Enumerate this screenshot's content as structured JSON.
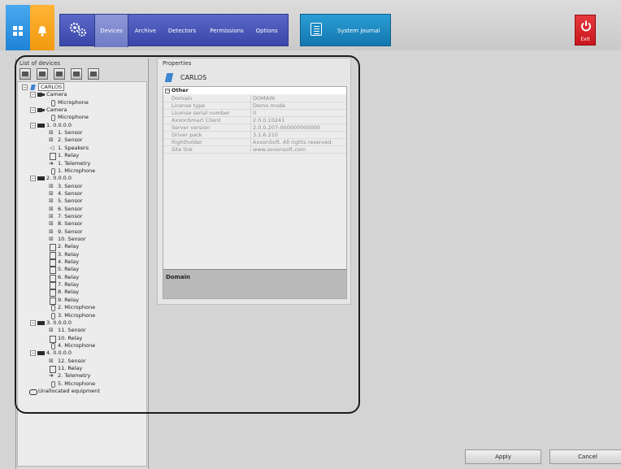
{
  "nav": {
    "tabs": [
      "Devices",
      "Archive",
      "Detectors",
      "Permissions",
      "Options"
    ],
    "active": "Devices",
    "journal": "System journal",
    "exit": "Exit",
    "colors": {
      "nav_blue": "#3a46a8",
      "journal_blue": "#1476b0",
      "exit_red": "#c8161c",
      "tile_blue": "#1f82d6",
      "tile_orange": "#f19a0f"
    }
  },
  "left_panel": {
    "title": "List of devices",
    "toolbar_icons": [
      "add-camera-icon",
      "add-device-icon",
      "add-sensor-icon",
      "add-relay-icon",
      "add-speaker-icon"
    ],
    "tree": [
      {
        "text": "CARLOS",
        "icon": "root"
      },
      {
        "text": "Camera",
        "icon": "cam"
      },
      {
        "text": "Microphone",
        "icon": "mic"
      },
      {
        "text": "Camera",
        "icon": "cam"
      },
      {
        "text": "Microphone",
        "icon": "mic"
      },
      {
        "text": "1. 0.0.0.0",
        "icon": "srv"
      },
      {
        "text": "1. Sensor",
        "icon": "sensor"
      },
      {
        "text": "2. Sensor",
        "icon": "sensor"
      },
      {
        "text": "1. Speakers",
        "icon": "spk"
      },
      {
        "text": "1. Relay",
        "icon": "relay"
      },
      {
        "text": "1. Telemetry",
        "icon": "tele"
      },
      {
        "text": "1. Microphone",
        "icon": "mic"
      },
      {
        "text": "2. 0.0.0.0",
        "icon": "srv"
      },
      {
        "text": "3. Sensor",
        "icon": "sensor"
      },
      {
        "text": "4. Sensor",
        "icon": "sensor"
      },
      {
        "text": "5. Sensor",
        "icon": "sensor"
      },
      {
        "text": "6. Sensor",
        "icon": "sensor"
      },
      {
        "text": "7. Sensor",
        "icon": "sensor"
      },
      {
        "text": "8. Sensor",
        "icon": "sensor"
      },
      {
        "text": "9. Sensor",
        "icon": "sensor"
      },
      {
        "text": "10. Sensor",
        "icon": "sensor"
      },
      {
        "text": "2. Relay",
        "icon": "relay"
      },
      {
        "text": "3. Relay",
        "icon": "relay"
      },
      {
        "text": "4. Relay",
        "icon": "relay"
      },
      {
        "text": "5. Relay",
        "icon": "relay"
      },
      {
        "text": "6. Relay",
        "icon": "relay"
      },
      {
        "text": "7. Relay",
        "icon": "relay"
      },
      {
        "text": "8. Relay",
        "icon": "relay"
      },
      {
        "text": "9. Relay",
        "icon": "relay"
      },
      {
        "text": "2. Microphone",
        "icon": "mic"
      },
      {
        "text": "3. Microphone",
        "icon": "mic"
      },
      {
        "text": "3. 0.0.0.0",
        "icon": "srv"
      },
      {
        "text": "11. Sensor",
        "icon": "sensor"
      },
      {
        "text": "10. Relay",
        "icon": "relay"
      },
      {
        "text": "4. Microphone",
        "icon": "mic"
      },
      {
        "text": "4. 0.0.0.0",
        "icon": "srv"
      },
      {
        "text": "12. Sensor",
        "icon": "sensor"
      },
      {
        "text": "11. Relay",
        "icon": "relay"
      },
      {
        "text": "2. Telemetry",
        "icon": "tele"
      },
      {
        "text": "5. Microphone",
        "icon": "mic"
      },
      {
        "text": "Unallocated equipment",
        "icon": "unalloc"
      }
    ]
  },
  "properties": {
    "title": "Properties",
    "device": "CARLOS",
    "section": "Other",
    "rows": [
      {
        "k": "Domain",
        "v": "DOMAIN"
      },
      {
        "k": "License type",
        "v": "Demo mode"
      },
      {
        "k": "License serial number",
        "v": "0"
      },
      {
        "k": "AxxonSmart Client",
        "v": "2.0.0.10241"
      },
      {
        "k": "Server version",
        "v": "2.0.0.207-000000000000"
      },
      {
        "k": "Driver pack",
        "v": "3.1.6.210"
      },
      {
        "k": "Rightholder",
        "v": "AxxonSoft. All rigths reserved."
      },
      {
        "k": "Site link",
        "v": "www.axxonsoft.com"
      }
    ],
    "description_title": "Domain"
  },
  "buttons": {
    "apply": "Apply",
    "cancel": "Cancel"
  }
}
